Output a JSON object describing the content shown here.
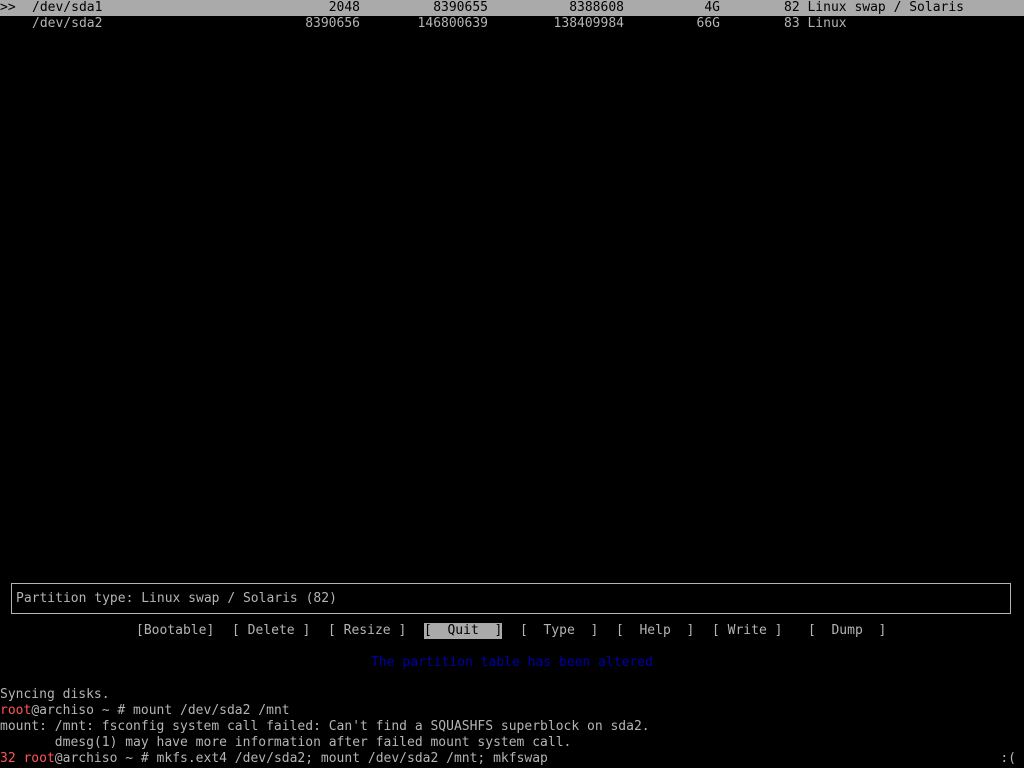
{
  "partitions": [
    {
      "marker": ">>",
      "device": "/dev/sda1",
      "start": "2048",
      "end": "8390655",
      "sectors": "8388608",
      "size": "4G",
      "id_type": "82 Linux swap / Solaris",
      "selected": true
    },
    {
      "marker": "",
      "device": "/dev/sda2",
      "start": "8390656",
      "end": "146800639",
      "sectors": "138409984",
      "size": "66G",
      "id_type": "83 Linux",
      "selected": false
    }
  ],
  "info": {
    "text": "Partition type: Linux swap / Solaris (82)"
  },
  "menu": {
    "bootable": "[Bootable]",
    "delete": "[ Delete ]",
    "resize": "[ Resize ]",
    "quit": "[  Quit  ]",
    "type": "[  Type  ]",
    "help": "[  Help  ]",
    "write": "[ Write ]",
    "dump": "[  Dump  ]"
  },
  "status": {
    "text": "The partition table has been altered"
  },
  "terminal": {
    "line1": "Syncing disks.",
    "line2_user": "root",
    "line2_rest": "@archiso ~ # mount /dev/sda2 /mnt",
    "line3": "mount: /mnt: fsconfig system call failed: Can't find a SQUASHFS superblock on sda2.",
    "line4": "       dmesg(1) may have more information after failed mount system call.",
    "line5_code": "32",
    "line5_user": "root",
    "line5_rest": "@archiso ~ # mkfs.ext4 /dev/sda2; mount /dev/sda2 /mnt; mkfswap",
    "line5_right": ":("
  }
}
